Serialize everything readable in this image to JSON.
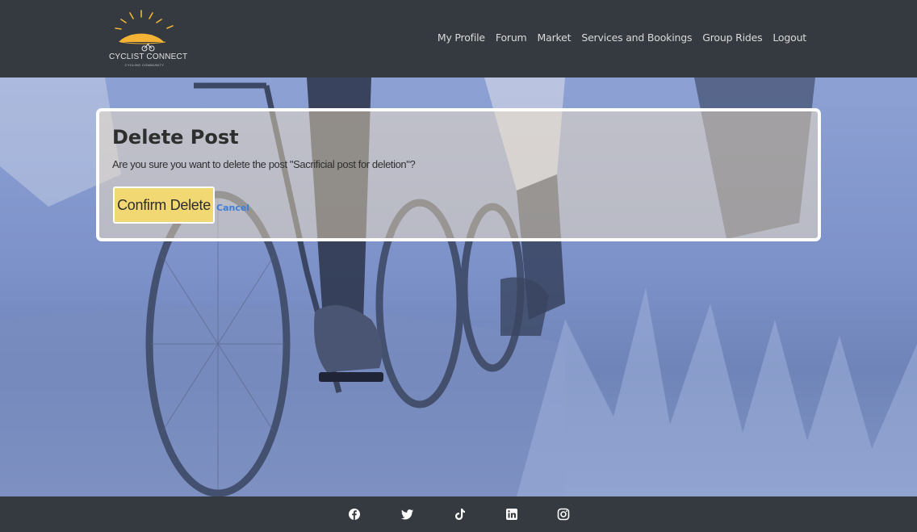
{
  "header": {
    "logo": {
      "name": "CYCLIST CONNECT",
      "tagline": "CYCLING COMMUNITY"
    },
    "nav": [
      {
        "label": "My Profile"
      },
      {
        "label": "Forum"
      },
      {
        "label": "Market"
      },
      {
        "label": "Services and Bookings"
      },
      {
        "label": "Group Rides"
      },
      {
        "label": "Logout"
      }
    ]
  },
  "dialog": {
    "title": "Delete Post",
    "message": "Are you sure you want to delete the post \"Sacrificial post for deletion\"?",
    "confirm_label": "Confirm Delete",
    "cancel_label": "Cancel"
  },
  "footer": {
    "social": [
      {
        "icon": "facebook-icon"
      },
      {
        "icon": "twitter-icon"
      },
      {
        "icon": "tiktok-icon"
      },
      {
        "icon": "linkedin-icon"
      },
      {
        "icon": "instagram-icon"
      }
    ]
  },
  "colors": {
    "header_bg": "#343a40",
    "confirm_bg": "#f1d873",
    "link": "#3b7fd6",
    "logo_sun": "#f5b335"
  }
}
